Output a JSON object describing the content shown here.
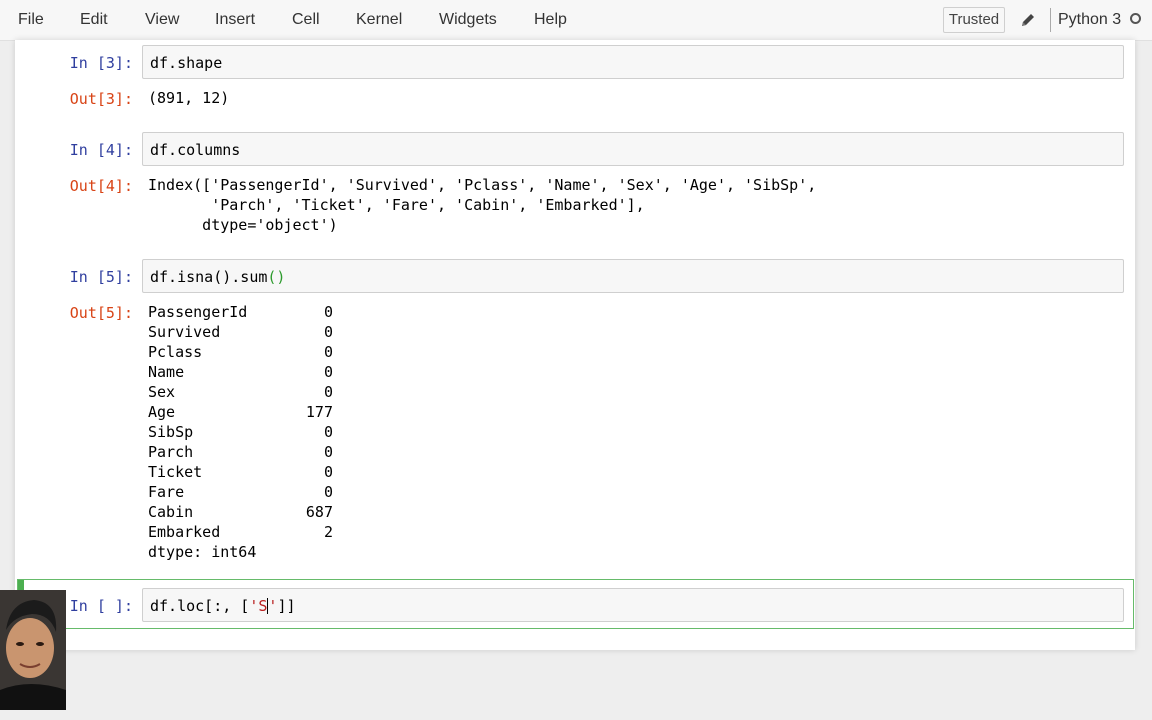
{
  "menu": {
    "items": [
      "File",
      "Edit",
      "View",
      "Insert",
      "Cell",
      "Kernel",
      "Widgets",
      "Help"
    ],
    "trusted_label": "Trusted",
    "kernel_name": "Python 3"
  },
  "cells": {
    "c3": {
      "in_prompt": "In [3]:",
      "code": "df.shape",
      "out_prompt": "Out[3]:",
      "output": "(891, 12)"
    },
    "c4": {
      "in_prompt": "In [4]:",
      "code": "df.columns",
      "out_prompt": "Out[4]:",
      "output_lines": [
        "Index(['PassengerId', 'Survived', 'Pclass', 'Name', 'Sex', 'Age', 'SibSp',",
        "       'Parch', 'Ticket', 'Fare', 'Cabin', 'Embarked'],",
        "      dtype='object')"
      ]
    },
    "c5": {
      "in_prompt": "In [5]:",
      "code": "df.isna().sum",
      "code_parens": "()",
      "out_prompt": "Out[5]:",
      "rows": [
        {
          "name": "PassengerId",
          "value": "0"
        },
        {
          "name": "Survived",
          "value": "0"
        },
        {
          "name": "Pclass",
          "value": "0"
        },
        {
          "name": "Name",
          "value": "0"
        },
        {
          "name": "Sex",
          "value": "0"
        },
        {
          "name": "Age",
          "value": "177"
        },
        {
          "name": "SibSp",
          "value": "0"
        },
        {
          "name": "Parch",
          "value": "0"
        },
        {
          "name": "Ticket",
          "value": "0"
        },
        {
          "name": "Fare",
          "value": "0"
        },
        {
          "name": "Cabin",
          "value": "687"
        },
        {
          "name": "Embarked",
          "value": "2"
        }
      ],
      "dtype": "dtype: int64"
    },
    "active": {
      "in_prompt": "In [ ]:",
      "code_prefix": "df.loc[:, [",
      "string_open": "'S",
      "string_close": "'",
      "code_suffix": "]]"
    }
  },
  "colors": {
    "in_prompt": "#303f9f",
    "out_prompt": "#d84315",
    "active_border": "#66bb6a"
  }
}
